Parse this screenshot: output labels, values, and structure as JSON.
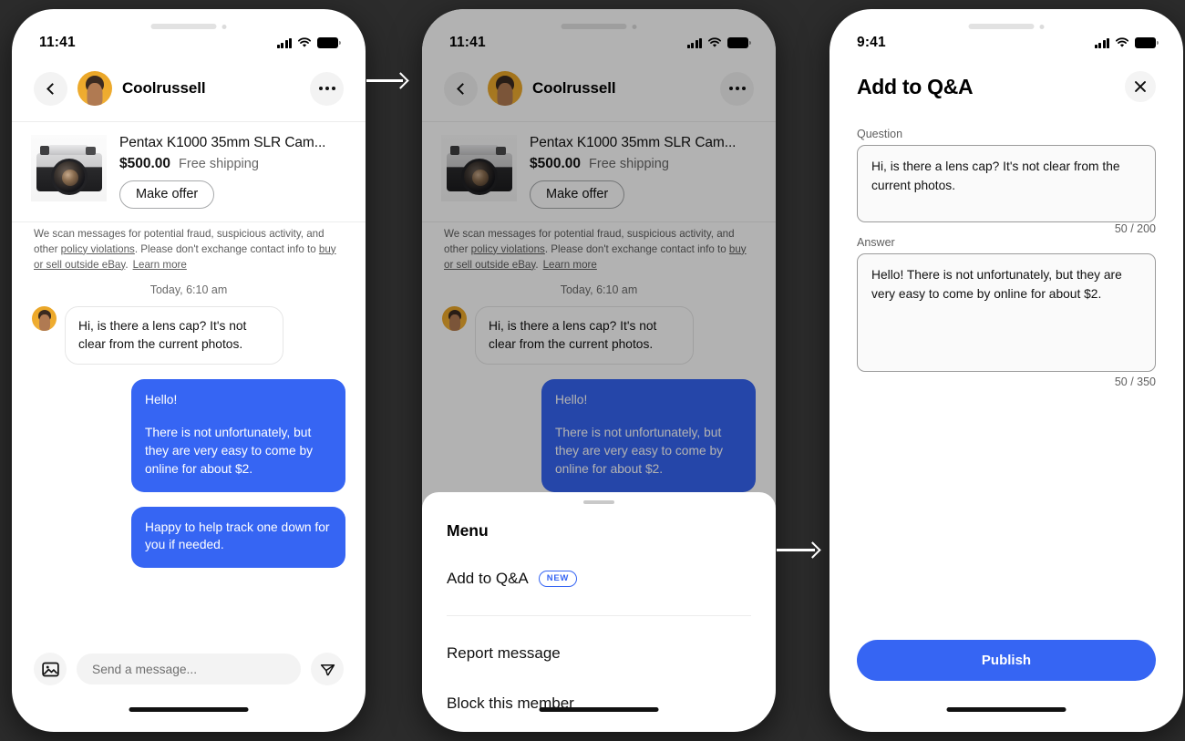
{
  "background_color": "#2c2c2c",
  "accent_color": "#3665f3",
  "panels": [
    {
      "id": "chat",
      "status_bar": {
        "time": "11:41",
        "signal_icon": "cellular-signal-icon",
        "wifi_icon": "wifi-icon",
        "battery_icon": "battery-icon"
      },
      "header": {
        "back_icon": "chevron-left-icon",
        "avatar_icon": "user-avatar",
        "username": "Coolrussell",
        "overflow_icon": "more-options-icon"
      },
      "item": {
        "photo_alt": "Pentax K1000 camera photo",
        "title": "Pentax K1000 35mm SLR Cam...",
        "price": "$500.00",
        "shipping": "Free shipping",
        "offer_button": "Make offer"
      },
      "notice": {
        "part1": "We scan messages for potential fraud, suspicious activity, and other ",
        "link1": "policy violations",
        "part2": ". Please don't exchange contact info to ",
        "link2": "buy or sell outside eBay",
        "part3": ".",
        "link3": "Learn more"
      },
      "timestamp": "Today,  6:10 am",
      "messages": [
        {
          "side": "in",
          "text": "Hi, is there a lens cap? It's not clear from the current photos."
        },
        {
          "side": "out",
          "lines": [
            "Hello!",
            "There is not unfortunately, but they are very easy to come by online for about $2."
          ]
        },
        {
          "side": "out",
          "lines": [
            "Happy to help track one down for you if needed."
          ]
        }
      ],
      "compose": {
        "image_icon": "image-attachment-icon",
        "placeholder": "Send a message...",
        "send_icon": "send-icon"
      }
    },
    {
      "id": "chat-with-menu",
      "status_bar": {
        "time": "11:41",
        "signal_icon": "cellular-signal-icon",
        "wifi_icon": "wifi-icon",
        "battery_icon": "battery-icon"
      },
      "header": {
        "back_icon": "chevron-left-icon",
        "avatar_icon": "user-avatar",
        "username": "Coolrussell",
        "overflow_icon": "more-options-icon"
      },
      "item": {
        "photo_alt": "Pentax K1000 camera photo",
        "title": "Pentax K1000 35mm SLR Cam...",
        "price": "$500.00",
        "shipping": "Free shipping",
        "offer_button": "Make offer"
      },
      "notice": {
        "part1": "We scan messages for potential fraud, suspicious activity, and other ",
        "link1": "policy violations",
        "part2": ". Please don't exchange contact info to ",
        "link2": "buy or sell outside eBay",
        "part3": ".",
        "link3": "Learn more"
      },
      "timestamp": "Today,  6:10 am",
      "messages": [
        {
          "side": "in",
          "text": "Hi, is there a lens cap? It's not clear from the current photos."
        },
        {
          "side": "out",
          "lines": [
            "Hello!",
            "There is not unfortunately, but they are very easy to come by online for about $2."
          ]
        }
      ],
      "sheet": {
        "grabber_icon": "drag-handle-icon",
        "title": "Menu",
        "items": [
          {
            "label": "Add to Q&A",
            "badge": "NEW"
          },
          {
            "label": "Report message",
            "badge": null
          },
          {
            "label": "Block this member",
            "badge": null
          }
        ]
      }
    },
    {
      "id": "add-to-qa",
      "status_bar": {
        "time": "9:41",
        "signal_icon": "cellular-signal-icon",
        "wifi_icon": "wifi-icon",
        "battery_icon": "battery-icon"
      },
      "title": "Add to Q&A",
      "close_icon": "close-icon",
      "question": {
        "label": "Question",
        "value": "Hi, is there a lens cap? It's not clear from the current photos.",
        "counter": "50 / 200"
      },
      "answer": {
        "label": "Answer",
        "value": "Hello! There is not unfortunately, but they are very easy to come by online for about $2.",
        "counter": "50 / 350"
      },
      "publish_button": "Publish"
    }
  ],
  "flow_arrows": [
    {
      "name": "arrow-panel1-to-panel2",
      "direction": "right"
    },
    {
      "name": "arrow-panel2-to-panel3",
      "direction": "right"
    }
  ]
}
